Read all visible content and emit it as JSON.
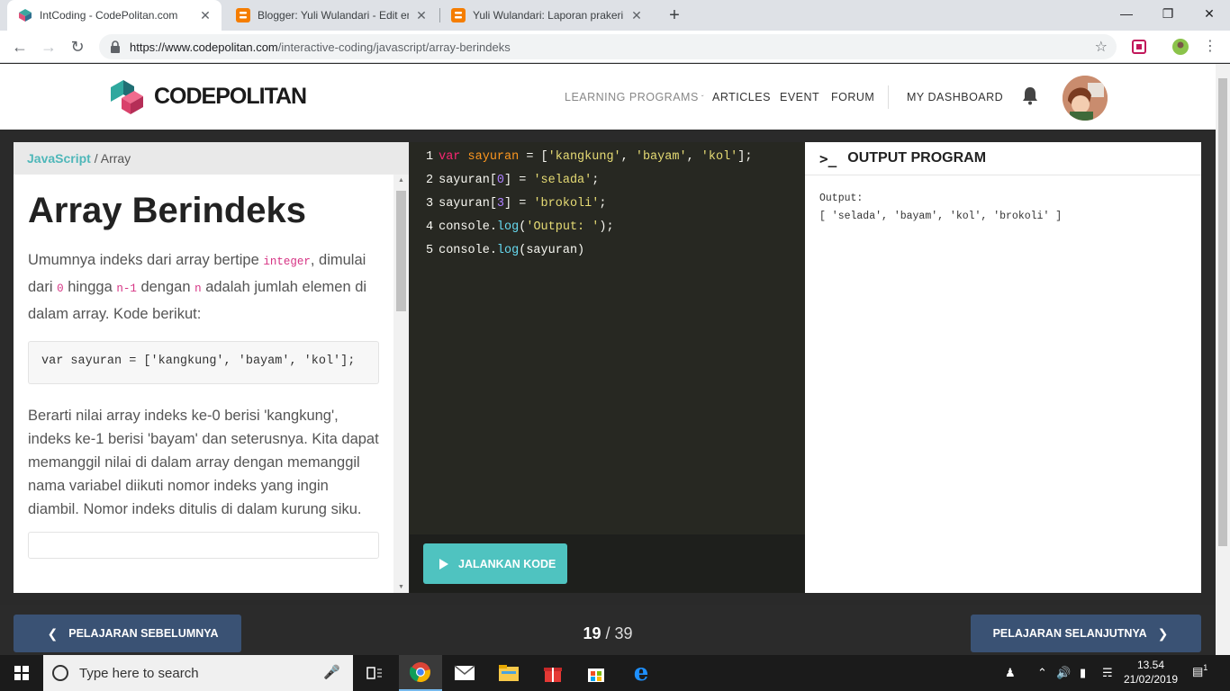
{
  "browser": {
    "tabs": [
      {
        "title": "IntCoding - CodePolitan.com",
        "close": "✕"
      },
      {
        "title": "Blogger: Yuli Wulandari - Edit ent",
        "close": "✕"
      },
      {
        "title": "Yuli Wulandari: Laporan prakerin",
        "close": "✕"
      }
    ],
    "new_tab": "+",
    "url_host": "https://www.codepolitan.com",
    "url_path": "/interactive-coding/javascript/array-berindeks",
    "window_controls": [
      "—",
      "❐",
      "✕"
    ]
  },
  "site": {
    "logo_bold": "CODE",
    "logo_rest": "POLITAN",
    "nav": {
      "learning_programs": "LEARNING PROGRAMS",
      "articles": "ARTICLES",
      "event": "EVENT",
      "forum": "FORUM",
      "dashboard": "MY DASHBOARD"
    }
  },
  "lesson": {
    "breadcrumb_lang": "JavaScript",
    "breadcrumb_rest": " / Array",
    "title": "Array Berindeks",
    "p1_a": "Umumnya indeks dari array bertipe ",
    "p1_code1": "integer",
    "p1_b": ", dimulai dari ",
    "p1_code2": "0",
    "p1_c": " hingga ",
    "p1_code3": "n-1",
    "p1_d": " dengan ",
    "p1_code4": "n",
    "p1_e": " adalah jumlah elemen di dalam array. Kode berikut:",
    "code_sample": "var sayuran = ['kangkung', 'bayam', 'kol'];",
    "p2": "Berarti nilai array indeks ke-0 berisi 'kangkung', indeks ke-1 berisi 'bayam' dan seterusnya. Kita dapat memanggil nilai di dalam array dengan memanggil nama variabel diikuti nomor indeks yang ingin diambil. Nomor indeks ditulis di dalam kurung siku."
  },
  "editor": {
    "lines": [
      {
        "n": "1",
        "t1": "var",
        "t2": " sayuran",
        "t3": " = [",
        "t4": "'kangkung'",
        "t5": ", ",
        "t6": "'bayam'",
        "t7": ", ",
        "t8": "'kol'",
        "t9": "];"
      },
      {
        "n": "2",
        "t1": "sayuran[",
        "t2": "0",
        "t3": "] = ",
        "t4": "'selada'",
        "t5": ";"
      },
      {
        "n": "3",
        "t1": "sayuran[",
        "t2": "3",
        "t3": "] = ",
        "t4": "'brokoli'",
        "t5": ";"
      },
      {
        "n": "4",
        "t1": "console.",
        "t2": "log",
        "t3": "(",
        "t4": "'Output: '",
        "t5": ");"
      },
      {
        "n": "5",
        "t1": "console.",
        "t2": "log",
        "t3": "(sayuran)"
      }
    ],
    "run_label": "JALANKAN KODE"
  },
  "output": {
    "heading": "OUTPUT PROGRAM",
    "prompt": ">_",
    "text": "Output:\n[ 'selada', 'bayam', 'kol', 'brokoli' ]"
  },
  "footer": {
    "prev_label": "PELAJARAN SEBELUMNYA",
    "next_label": "PELAJARAN SELANJUTNYA",
    "page_current": "19",
    "page_sep": " / ",
    "page_total": "39"
  },
  "taskbar": {
    "search_placeholder": "Type here to search",
    "time": "13.54",
    "date": "21/02/2019",
    "notification_count": "1"
  },
  "colors": {
    "accent_teal": "#4fc3c0",
    "nav_button": "#3a5274",
    "editor_bg": "#272822"
  }
}
